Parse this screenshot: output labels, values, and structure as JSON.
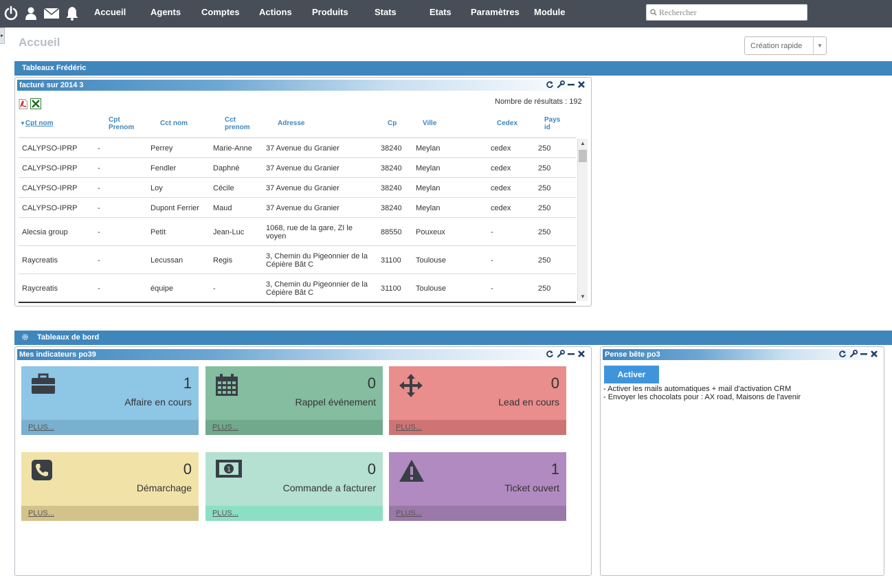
{
  "nav": {
    "items": [
      "Accueil",
      "Agents",
      "Comptes",
      "Actions",
      "Produits",
      "Stats",
      "Etats",
      "Paramètres",
      "Module"
    ],
    "search_placeholder": "Rechercher"
  },
  "page": {
    "title": "Accueil",
    "quick_create": "Création rapide"
  },
  "section1": {
    "title": "Tableaux Frédéric",
    "panel_title": "facturé sur 2014   3",
    "result_count": "Nombre de résultats : 192",
    "columns": [
      "Cpt nom",
      "Cpt\nPrenom",
      "Cct nom",
      "Cct\nprenom",
      "Adresse",
      "Cp",
      "Ville",
      "Cedex",
      "Pays\nid"
    ],
    "rows": [
      [
        "CALYPSO-IPRP",
        "-",
        "Perrey",
        "Marie-Anne",
        "37 Avenue du Granier",
        "38240",
        "Meylan",
        "cedex",
        "250"
      ],
      [
        "CALYPSO-IPRP",
        "-",
        "Fendler",
        "Daphné",
        "37 Avenue du Granier",
        "38240",
        "Meylan",
        "cedex",
        "250"
      ],
      [
        "CALYPSO-IPRP",
        "-",
        "Loy",
        "Cécile",
        "37 Avenue du Granier",
        "38240",
        "Meylan",
        "cedex",
        "250"
      ],
      [
        "CALYPSO-IPRP",
        "-",
        "Dupont Ferrier",
        "Maud",
        "37 Avenue du Granier",
        "38240",
        "Meylan",
        "cedex",
        "250"
      ],
      [
        "Alecsia group",
        "-",
        "Petit",
        "Jean-Luc",
        "1068, rue de la gare, ZI le voyen",
        "88550",
        "Pouxeux",
        "-",
        "250"
      ],
      [
        "Raycreatis",
        "-",
        "Lecussan",
        "Regis",
        "3, Chemin du Pigeonnier de la Cépière Bât C",
        "31100",
        "Toulouse",
        "-",
        "250"
      ],
      [
        "Raycreatis",
        "-",
        "équipe",
        "-",
        "3, Chemin du Pigeonnier de la Cépière Bât C",
        "31100",
        "Toulouse",
        "-",
        "250"
      ]
    ]
  },
  "section2": {
    "title": "Tableaux de bord",
    "indicators_title": "Mes indicateurs   po39",
    "plus_label": "PLUS...",
    "tiles": [
      {
        "icon": "briefcase-icon",
        "count": "1",
        "label": "Affaire en cours",
        "bg": "#8ec6e6",
        "foot": "#7ab0cf"
      },
      {
        "icon": "calendar-icon",
        "count": "0",
        "label": "Rappel événement",
        "bg": "#84bda0",
        "foot": "#70a98b"
      },
      {
        "icon": "move-arrows-icon",
        "count": "0",
        "label": "Lead en cours",
        "bg": "#e98d8d",
        "foot": "#cf7474"
      },
      {
        "icon": "phone-icon",
        "count": "0",
        "label": "Démarchage",
        "bg": "#f1e3a8",
        "foot": "#d3c38a"
      },
      {
        "icon": "banknote-icon",
        "count": "0",
        "label": "Commande a facturer",
        "bg": "#b4e1d1",
        "foot": "#8ddfc3"
      },
      {
        "icon": "warning-icon",
        "count": "1",
        "label": "Ticket ouvert",
        "bg": "#b08ac0",
        "foot": "#9a78a8"
      }
    ],
    "memo_title": "Pense bête   po3",
    "memo_button": "Activer",
    "memo_lines": [
      "- Activer les mails automatiques + mail d'activation CRM",
      "- Envoyer les chocolats pour : AX road, Maisons de l'avenir"
    ]
  }
}
